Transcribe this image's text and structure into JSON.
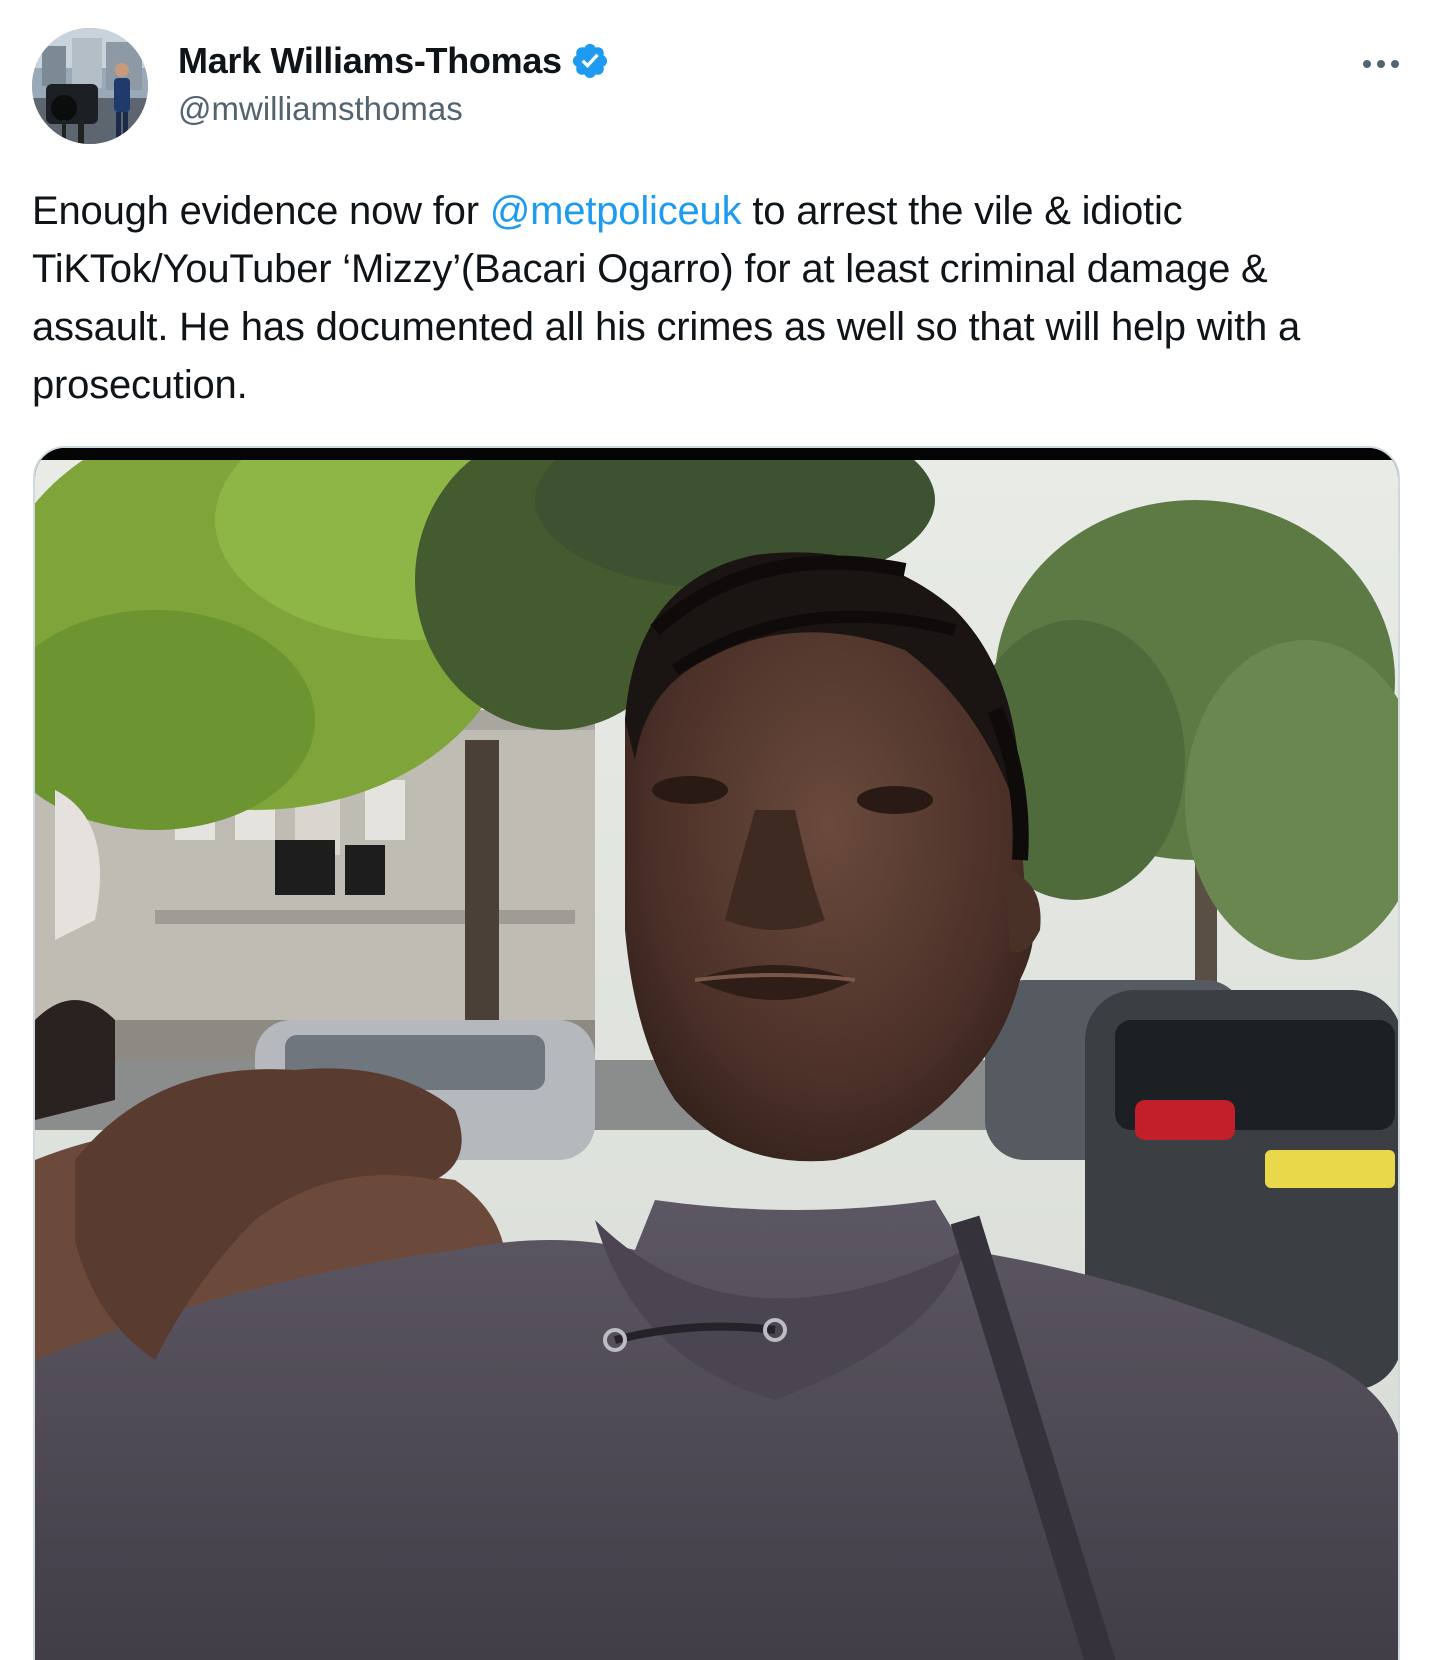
{
  "author": {
    "display_name": "Mark Williams-Thomas",
    "handle": "@mwilliamsthomas",
    "verified": true
  },
  "tweet": {
    "text_before_mention": "Enough evidence now for ",
    "mention": "@metpoliceuk",
    "text_after_mention": " to arrest the vile & idiotic TiKTok/YouTuber ‘Mizzy’(Bacari Ogarro) for at least criminal damage & assault. He has documented all his crimes as well so that will help with a prosecution."
  },
  "icons": {
    "verified": "verified-badge-icon",
    "more": "more-options-icon"
  },
  "colors": {
    "link": "#1d9bf0",
    "verified_badge": "#1d9bf0",
    "secondary_text": "#536471",
    "primary_text": "#0f1419"
  }
}
